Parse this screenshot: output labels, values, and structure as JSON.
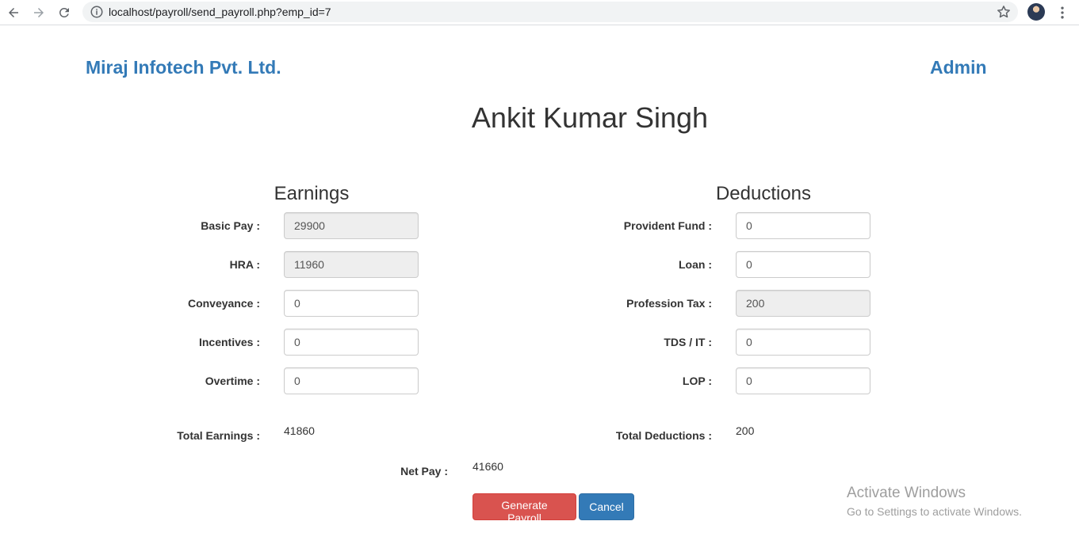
{
  "browser": {
    "url": "localhost/payroll/send_payroll.php?emp_id=7"
  },
  "header": {
    "company": "Miraj Infotech Pvt. Ltd.",
    "user": "Admin"
  },
  "employee_name": "Ankit Kumar Singh",
  "earnings": {
    "title": "Earnings",
    "basic_pay": {
      "label": "Basic Pay :",
      "value": "29900"
    },
    "hra": {
      "label": "HRA :",
      "value": "11960"
    },
    "conveyance": {
      "label": "Conveyance :",
      "value": "0"
    },
    "incentives": {
      "label": "Incentives :",
      "value": "0"
    },
    "overtime": {
      "label": "Overtime :",
      "value": "0"
    },
    "total": {
      "label": "Total Earnings :",
      "value": "41860"
    }
  },
  "deductions": {
    "title": "Deductions",
    "provident_fund": {
      "label": "Provident Fund :",
      "value": "0"
    },
    "loan": {
      "label": "Loan :",
      "value": "0"
    },
    "profession_tax": {
      "label": "Profession Tax :",
      "value": "200"
    },
    "tds_it": {
      "label": "TDS / IT :",
      "value": "0"
    },
    "lop": {
      "label": "LOP :",
      "value": "0"
    },
    "total": {
      "label": "Total Deductions :",
      "value": "200"
    }
  },
  "net_pay": {
    "label": "Net Pay :",
    "value": "41660"
  },
  "actions": {
    "generate": "Generate Payroll",
    "cancel": "Cancel"
  },
  "watermark": {
    "line1": "Activate Windows",
    "line2": "Go to Settings to activate Windows."
  }
}
